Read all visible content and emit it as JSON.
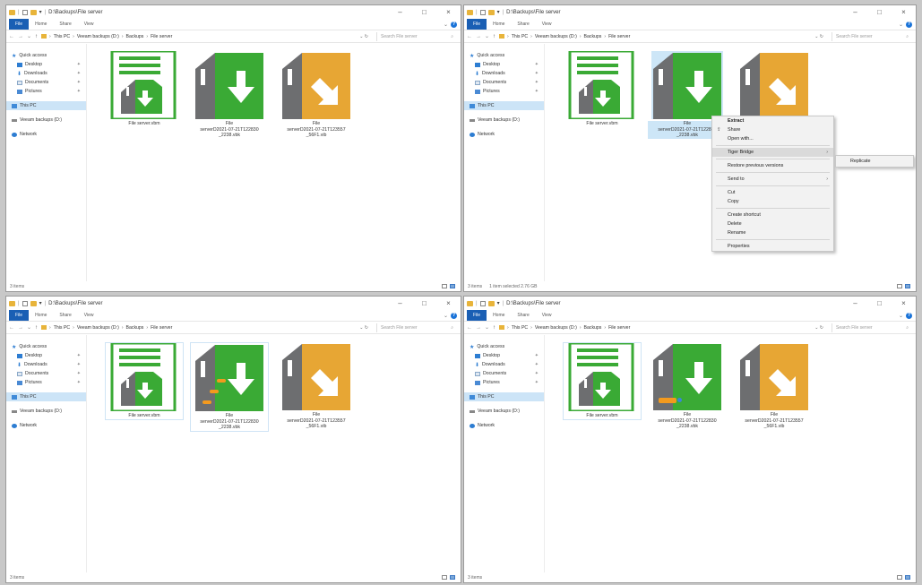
{
  "windows": [
    {
      "title": "D:\\Backups\\File server",
      "ribbon_tabs": [
        "File",
        "Home",
        "Share",
        "View"
      ],
      "breadcrumb": [
        "This PC",
        "Veeam backups (D:)",
        "Backups",
        "File server"
      ],
      "search_placeholder": "Search File server",
      "status_text": "3 items",
      "status_selected": ""
    },
    {
      "title": "D:\\Backups\\File server",
      "ribbon_tabs": [
        "File",
        "Home",
        "Share",
        "View"
      ],
      "breadcrumb": [
        "This PC",
        "Veeam backups (D:)",
        "Backups",
        "File server"
      ],
      "search_placeholder": "Search File server",
      "status_text": "3 items",
      "status_selected": "1 item selected  2.76 GB"
    },
    {
      "title": "D:\\Backups\\File server",
      "ribbon_tabs": [
        "File",
        "Home",
        "Share",
        "View"
      ],
      "breadcrumb": [
        "This PC",
        "Veeam backups (D:)",
        "Backups",
        "File server"
      ],
      "search_placeholder": "Search File server",
      "status_text": "3 items",
      "status_selected": ""
    },
    {
      "title": "D:\\Backups\\File server",
      "ribbon_tabs": [
        "File",
        "Home",
        "Share",
        "View"
      ],
      "breadcrumb": [
        "This PC",
        "Veeam backups (D:)",
        "Backups",
        "File server"
      ],
      "search_placeholder": "Search File server",
      "status_text": "3 items",
      "status_selected": ""
    }
  ],
  "sidebar": {
    "items": [
      {
        "label": "Quick access",
        "icon": "star-icon"
      },
      {
        "label": "Desktop",
        "icon": "desktop-icon"
      },
      {
        "label": "Downloads",
        "icon": "download-icon"
      },
      {
        "label": "Documents",
        "icon": "document-icon"
      },
      {
        "label": "Pictures",
        "icon": "pictures-icon"
      },
      {
        "label": "This PC",
        "icon": "pc-icon"
      },
      {
        "label": "Veeam backups (D:)",
        "icon": "drive-icon"
      },
      {
        "label": "Network",
        "icon": "network-icon"
      }
    ]
  },
  "files": [
    {
      "label_l1": "File server.vbm",
      "label_l2": "",
      "label_l3": "",
      "icon": "veeam-vbm-icon"
    },
    {
      "label_l1": "File",
      "label_l2": "serverD2021-07-21T122830",
      "label_l3": "_2238.vbk",
      "icon": "veeam-vbk-icon"
    },
    {
      "label_l1": "File",
      "label_l2": "serverD2021-07-21T123557",
      "label_l3": "_56F1.vib",
      "icon": "veeam-vib-icon"
    }
  ],
  "context_menu": {
    "items": [
      "Extract",
      "Share",
      "Open with...",
      "Tiger Bridge",
      "Restore previous versions",
      "Send to",
      "Cut",
      "Copy",
      "Create shortcut",
      "Delete",
      "Rename",
      "Properties"
    ],
    "submenu": [
      "Replicate"
    ]
  },
  "window2_label": "File serverD2021-07-21T12",
  "colors": {
    "green": "#3aaa35",
    "gray": "#6d6e70",
    "orange": "#e7a634",
    "accent": "#1a5fb4",
    "tag": "#f39a1e"
  }
}
